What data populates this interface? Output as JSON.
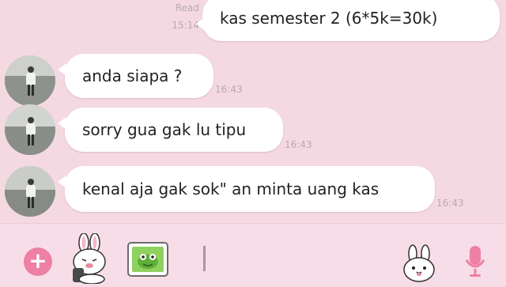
{
  "messages": {
    "outgoing": {
      "read_label": "Read",
      "time": "15:14",
      "text": "kas semester 2 (6*5k=30k)"
    },
    "incoming": [
      {
        "text": "anda siapa ?",
        "time": "16:43"
      },
      {
        "text": "sorry gua gak lu tipu",
        "time": "16:43"
      },
      {
        "text": "kenal aja gak sok\" an minta uang kas",
        "time": "16:43"
      }
    ]
  },
  "input_bar": {
    "plus_icon": "plus-icon",
    "sticker_icon": "bunny-sticker-icon",
    "gallery_icon": "photo-icon",
    "emoji_icon": "bunny-face-icon",
    "mic_icon": "microphone-icon",
    "input_value": ""
  },
  "colors": {
    "chat_background": "#f4d9e3",
    "bubble": "#ffffff",
    "accent_pink": "#ee7fa5",
    "timestamp": "#b9a8b3"
  }
}
